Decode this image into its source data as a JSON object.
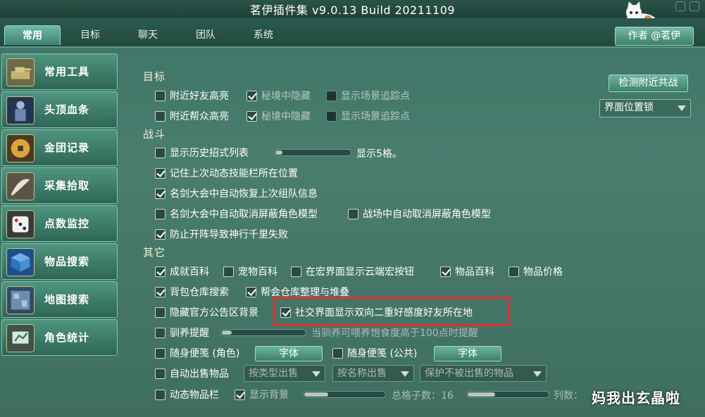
{
  "title": "茗伊插件集 v9.0.13 Build 20211109",
  "tabs": [
    {
      "label": "常用",
      "active": true
    },
    {
      "label": "目标",
      "active": false
    },
    {
      "label": "聊天",
      "active": false
    },
    {
      "label": "团队",
      "active": false
    },
    {
      "label": "系统",
      "active": false
    }
  ],
  "author_button": "作者 @茗伊",
  "sidebar": {
    "items": [
      {
        "label": "常用工具",
        "icon": "tank-icon"
      },
      {
        "label": "头顶血条",
        "icon": "warrior-icon"
      },
      {
        "label": "金团记录",
        "icon": "coin-icon"
      },
      {
        "label": "采集拾取",
        "icon": "fan-icon"
      },
      {
        "label": "点数监控",
        "icon": "dice-icon"
      },
      {
        "label": "物品搜索",
        "icon": "cube-icon"
      },
      {
        "label": "地图搜索",
        "icon": "map-icon"
      },
      {
        "label": "角色统计",
        "icon": "stats-icon"
      }
    ]
  },
  "right_panel": {
    "detect_button": "检测附近共战",
    "position_lock_dropdown": "界面位置锁"
  },
  "sections": {
    "target": {
      "title": "目标",
      "row1": {
        "a": "附近好友高亮",
        "b": "秘境中隐藏",
        "c": "显示场景追踪点"
      },
      "row2": {
        "a": "附近帮众高亮",
        "b": "秘境中隐藏",
        "c": "显示场景追踪点"
      }
    },
    "battle": {
      "title": "战斗",
      "history_list": "显示历史招式列表",
      "history_count": "显示5格。",
      "history_slider_fraction": 0.1,
      "remember_skillbar": "记住上次动态技能栏所在位置",
      "auto_restore_team": "名剑大会中自动恢复上次组队信息",
      "auto_cancel_hide_models": "名剑大会中自动取消屏蔽角色模型",
      "battlefield_cancel_hide": "战场中自动取消屏蔽角色模型",
      "prevent_formation": "防止开阵导致神行千里失败"
    },
    "other": {
      "title": "其它",
      "achievements": "成就百科",
      "pets": "宠物百科",
      "cloud_macro": "在宏界面显示云端宏按钮",
      "item_wiki": "物品百科",
      "item_price": "物品价格",
      "bag_search": "背包仓库搜索",
      "guild_sort": "帮会仓库整理与堆叠",
      "hide_notice_bg": "隐藏官方公告区背景",
      "social_friend_location": "社交界面显示双向二重好感度好友所在地",
      "taming_reminder": "驯养提醒",
      "taming_hint": "当驯养可喂养饱食度高于100点时提醒",
      "taming_slider_fraction": 0.12,
      "memo_role": "随身便笺 (角色)",
      "font_button": "字体",
      "memo_public": "随身便笺 (公共)",
      "auto_sell": "自动出售物品",
      "sell_by_type": "按类型出售",
      "sell_by_name": "按名称出售",
      "protect_items": "保护不被出售的物品",
      "dynamic_bar": "动态物品栏",
      "show_bg": "显示背景",
      "bg_slider_fraction": 0.3,
      "total_slots": "总格子数：16",
      "total_slider_fraction": 0.35,
      "columns": "列数："
    }
  },
  "watermark": "妈我出玄晶啦",
  "colors": {
    "background": "#4a7d6e",
    "sidebar_item": "#3f7f6c",
    "highlight": "#e03131",
    "text": "#ffffff"
  }
}
